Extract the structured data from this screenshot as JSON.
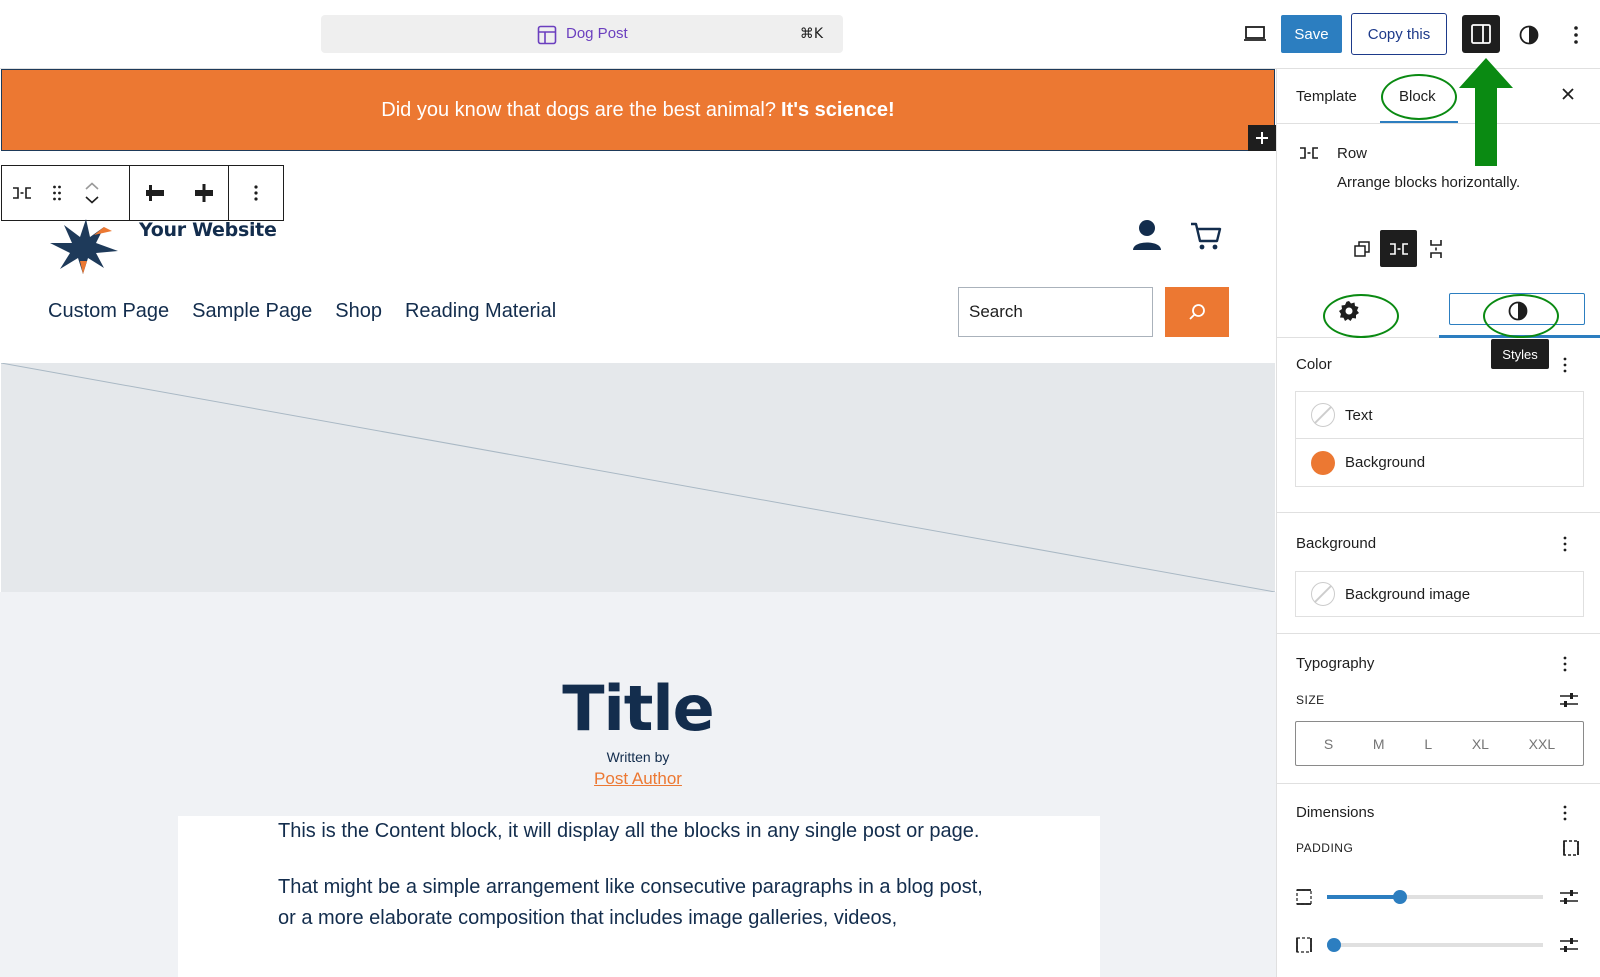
{
  "topbar": {
    "document_title": "Dog Post",
    "shortcut": "⌘K",
    "save_label": "Save",
    "copy_label": "Copy this"
  },
  "canvas": {
    "banner_text": "Did you know that dogs are the best animal?",
    "banner_bold": "It's science!",
    "site_title": "Your Website",
    "nav": [
      "Custom Page",
      "Sample Page",
      "Shop",
      "Reading Material"
    ],
    "search_placeholder": "Search",
    "post_title": "Title",
    "written_by": "Written by",
    "post_author": "Post Author",
    "content_paragraphs": [
      "This is the Content block, it will display all the blocks in any single post or page.",
      "That might be a simple arrangement like consecutive paragraphs in a blog post, or a more elaborate composition that includes image galleries, videos,"
    ],
    "colors": {
      "banner": "#ec7832",
      "navy": "#132d4d",
      "accent_blue": "#2c7ec0"
    }
  },
  "sidebar": {
    "tabs": {
      "template": "Template",
      "block": "Block"
    },
    "block_name": "Row",
    "block_desc": "Arrange blocks horizontally.",
    "tooltip": "Styles",
    "color": {
      "heading": "Color",
      "items": [
        "Text",
        "Background"
      ]
    },
    "background": {
      "heading": "Background",
      "items": [
        "Background image"
      ]
    },
    "typography": {
      "heading": "Typography",
      "size_label": "SIZE",
      "sizes": [
        "S",
        "M",
        "L",
        "XL",
        "XXL"
      ]
    },
    "dimensions": {
      "heading": "Dimensions",
      "padding_label": "PADDING",
      "padding_vertical_level": 0.34,
      "padding_horizontal_level": 0.0
    }
  }
}
